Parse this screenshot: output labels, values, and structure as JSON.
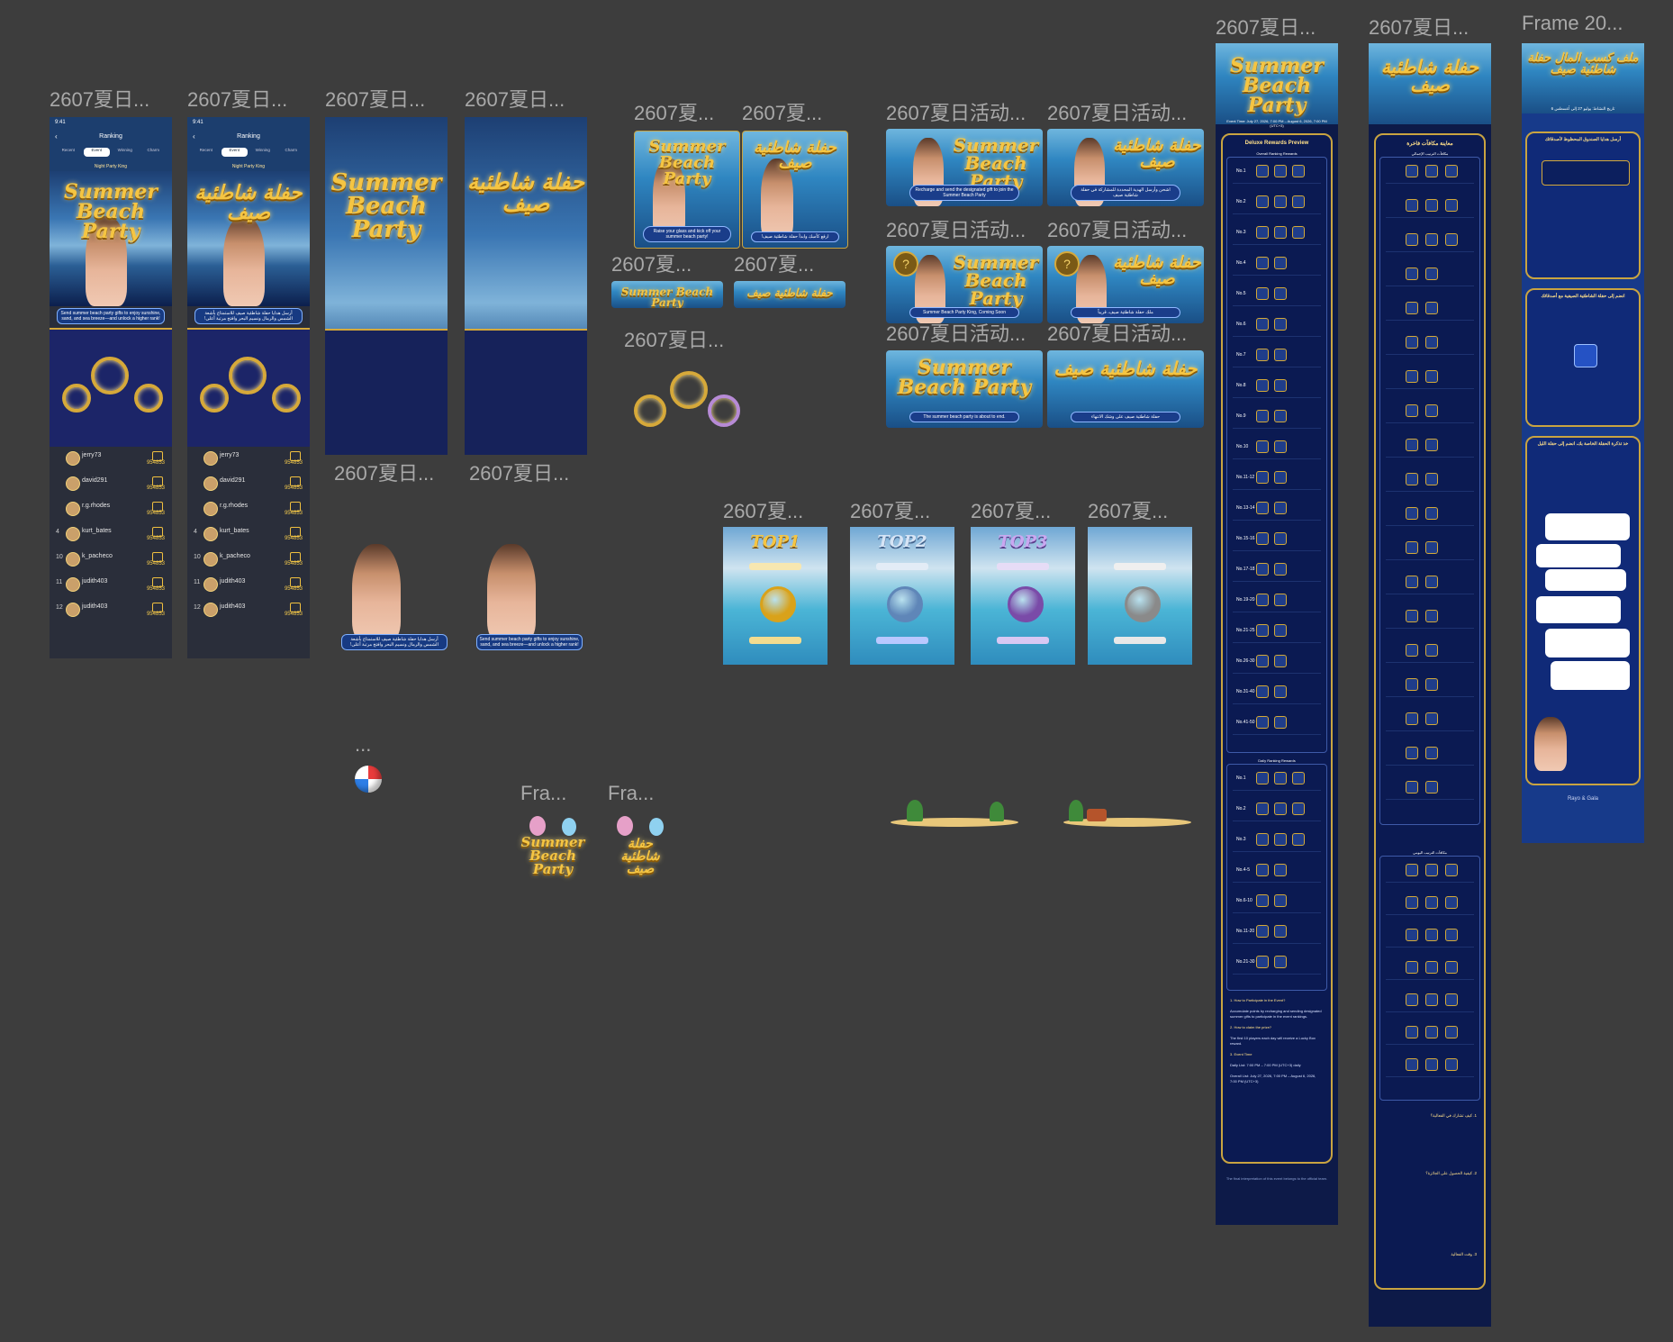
{
  "labels": {
    "a": "2607夏日...",
    "b": "2607夏...",
    "c": "2607夏日活动...",
    "frame20": "Frame 20...",
    "fra": "Fra...",
    "dots": "..."
  },
  "banner_en": "Summer Beach Party",
  "banner_ar": "حفلة شاطئية صيف",
  "ranking": {
    "status_time": "9:41",
    "nav_title": "Ranking",
    "tabs": [
      "Recent",
      "Event",
      "Winning",
      "Charm"
    ],
    "king_label": "Night Party King",
    "bubble_en": "Send summer beach party gifts to enjoy sunshine, sand, and sea breeze—and unlock a higher rank!",
    "bubble_ar": "أرسل هدايا حفلة شاطئية صيف للاستمتاع بأشعة الشمس والرمال ونسيم البحر وافتح مرتبة أعلى!",
    "rows": [
      {
        "rank": "",
        "name": "jerry73",
        "points": "954853"
      },
      {
        "rank": "",
        "name": "david291",
        "points": "954853"
      },
      {
        "rank": "",
        "name": "r.g.rhodes",
        "points": "954853"
      },
      {
        "rank": "4",
        "name": "kurt_bates",
        "points": "954853"
      },
      {
        "rank": "10",
        "name": "k_pacheco",
        "points": "954853"
      },
      {
        "rank": "11",
        "name": "judith403",
        "points": "954853"
      },
      {
        "rank": "12",
        "name": "judith403",
        "points": "954853"
      }
    ]
  },
  "mini_banners": {
    "en_caption": "Raise your glass and kick off your summer beach party!",
    "ar_caption": "ارفع كأسك وابدأ حفلة شاطئية صيف!"
  },
  "promo": [
    {
      "en": "Recharge and send the designated gift to join the Summer Beach Party",
      "ar": "اشحن وأرسل الهدية المحددة للمشاركة في حفلة شاطئية صيف"
    },
    {
      "en": "Summer Beach Party King, Coming Soon",
      "ar": "ملك حفلة شاطئية صيف، قريباً"
    },
    {
      "en": "The summer beach party is about to end.",
      "ar": "حفلة شاطئية صيف على وشك الانتهاء"
    }
  ],
  "top_cards": [
    "TOP1",
    "TOP2",
    "TOP3",
    ""
  ],
  "medal_colors": [
    "#d9a21a",
    "#5f86b8",
    "#7a4ba8",
    "#8a8a8a"
  ],
  "detail_en": {
    "event_time": "Event Time: July 27, 2026, 7:00 PM – August 6, 2026, 7:00 PM (UTC+3)",
    "section_title": "Deluxe Rewards Preview",
    "overall": "Overall Ranking Rewards",
    "daily": "Daily Ranking Rewards",
    "overall_ranks": [
      "No.1",
      "No.2",
      "No.3",
      "No.4",
      "No.5",
      "No.6",
      "No.7",
      "No.8",
      "No.9",
      "No.10",
      "No.11-12",
      "No.13-14",
      "No.15-16",
      "No.17-18",
      "No.19-20",
      "No.21-25",
      "No.26-30",
      "No.31-40",
      "No.41-50"
    ],
    "daily_ranks": [
      "No.1",
      "No.2",
      "No.3",
      "No.4-5",
      "No.6-10",
      "No.11-20",
      "No.21-30"
    ],
    "rules": [
      "1. How to Participate in the Event?",
      "Accumulate points by recharging and sending designated summer gifts to participate in the event rankings.",
      "2. How to claim the prize?",
      "The first 10 players each day will receive a Lucky Box reward.",
      "3. Event Time",
      "Daily List: 7:00 PM – 7:00 PM (UTC+3) daily",
      "Overall List: July 27, 2026, 7:00 PM – August 6, 2026, 7:00 PM (UTC+3)"
    ],
    "footer": "The final interpretation of this event belongs to the official team."
  },
  "detail_ar": {
    "section_title": "معاينة مكافآت فاخرة",
    "overall": "مكافآت الترتيب الإجمالي",
    "daily": "مكافآت الترتيب اليومي",
    "q1": "1. كيف تشارك في الفعالية؟",
    "q2": "2. كيفية الحصول على الجائزة؟",
    "q3": "3. وقت الفعالية"
  },
  "frame20": {
    "title": "ملف كسب المال حفلة شاطئية صيف",
    "date": "تاريخ النشاط: يوليو 27 إلى أغسطس 6",
    "sec1": "أرسل هدايا الصندوق المحظوظ لأصدقائك",
    "sec2": "انضم إلى حفلة الشاطئية الصيفية مع أصدقائك",
    "sec3": "خذ تذكرة الحفلة الخاصة بك، انضم إلى حفلة الليل",
    "brands": [
      "Rayo",
      "Gala"
    ]
  }
}
